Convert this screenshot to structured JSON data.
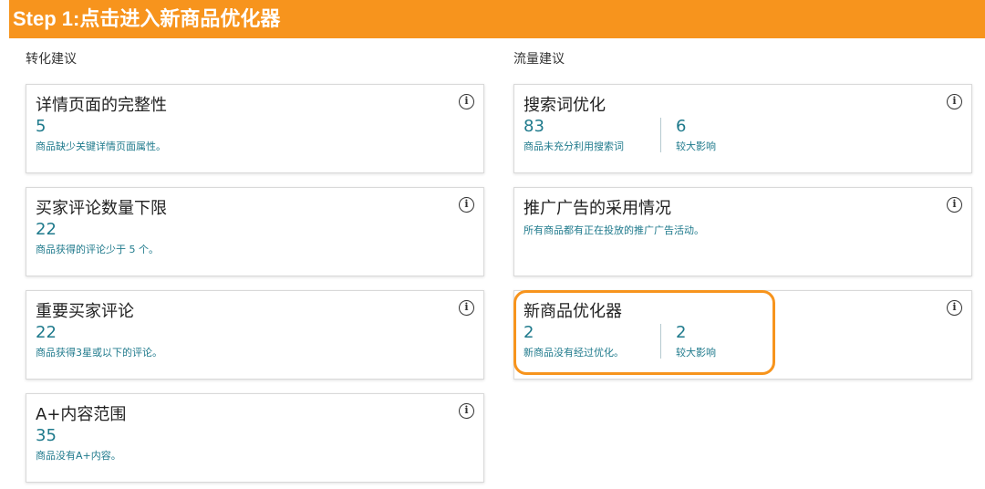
{
  "banner": {
    "title": "Step 1:点击进入新商品优化器"
  },
  "left_section": {
    "title": "转化建议",
    "cards": [
      {
        "title": "详情页面的完整性",
        "value": "5",
        "desc": "商品缺少关键详情页面属性。"
      },
      {
        "title": "买家评论数量下限",
        "value": "22",
        "desc": "商品获得的评论少于 5 个。"
      },
      {
        "title": "重要买家评论",
        "value": "22",
        "desc": "商品获得3星或以下的评论。"
      },
      {
        "title": "A+内容范围",
        "value": "35",
        "desc": "商品没有A+内容。"
      }
    ]
  },
  "right_section": {
    "title": "流量建议",
    "cards": [
      {
        "title": "搜索词优化",
        "value": "83",
        "desc": "商品未充分利用搜索词",
        "value2": "6",
        "desc2": "较大影响"
      },
      {
        "title": "推广广告的采用情况",
        "desc": "所有商品都有正在投放的推广广告活动。"
      },
      {
        "title": "新商品优化器",
        "value": "2",
        "desc": "新商品没有经过优化。",
        "value2": "2",
        "desc2": "较大影响"
      }
    ]
  },
  "info_icon_glyph": "i",
  "colors": {
    "banner": "#f7941d",
    "metric": "#1f7a8c",
    "highlight": "#f7941d"
  }
}
